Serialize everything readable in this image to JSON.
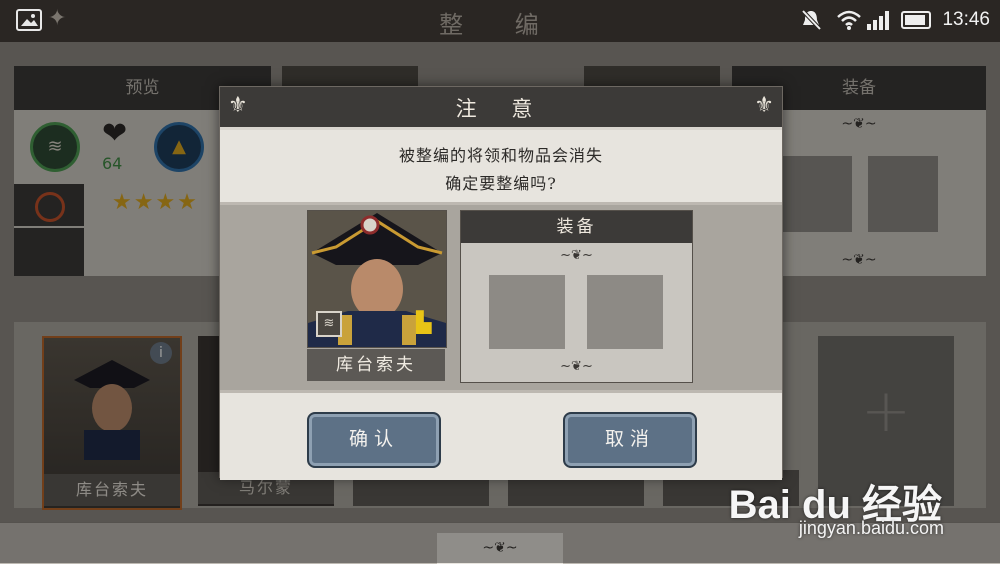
{
  "status_bar": {
    "screen_title": "整 编",
    "time": "13:46"
  },
  "background": {
    "preview_label": "预览",
    "health_value": "64",
    "equipment_label": "装备",
    "roster": [
      {
        "name": "库台索夫"
      },
      {
        "name": "马尔蒙"
      }
    ]
  },
  "dialog": {
    "title": "注 意",
    "message_line1": "被整编的将领和物品会消失",
    "message_line2": "确定要整编吗?",
    "general_name": "库台索夫",
    "equipment_header": "装备",
    "confirm_label": "确认",
    "cancel_label": "取消"
  },
  "watermark": {
    "brand": "Bai du 经验",
    "url": "jingyan.baidu.com"
  },
  "colors": {
    "button_blue": "#5d7186",
    "header_dark": "#3c3a38",
    "panel_light": "#e7e4de",
    "star_gold": "#d9a520"
  }
}
